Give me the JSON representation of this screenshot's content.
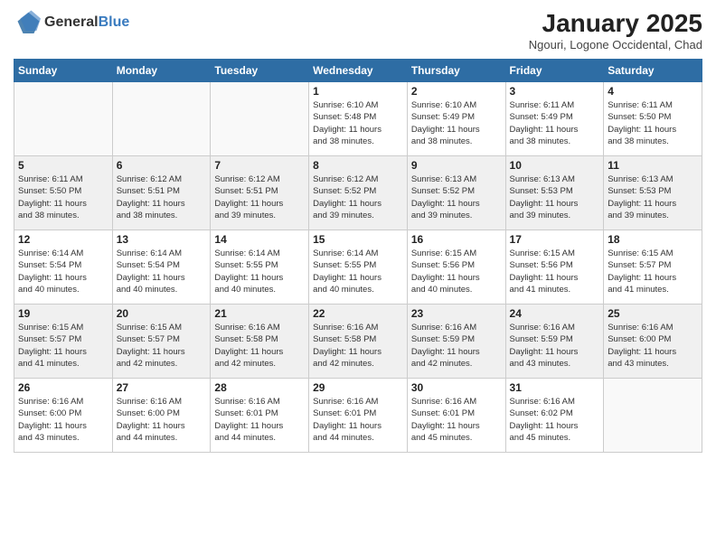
{
  "header": {
    "logo_general": "General",
    "logo_blue": "Blue",
    "title": "January 2025",
    "location": "Ngouri, Logone Occidental, Chad"
  },
  "days_of_week": [
    "Sunday",
    "Monday",
    "Tuesday",
    "Wednesday",
    "Thursday",
    "Friday",
    "Saturday"
  ],
  "weeks": [
    [
      {
        "day": "",
        "info": ""
      },
      {
        "day": "",
        "info": ""
      },
      {
        "day": "",
        "info": ""
      },
      {
        "day": "1",
        "info": "Sunrise: 6:10 AM\nSunset: 5:48 PM\nDaylight: 11 hours\nand 38 minutes."
      },
      {
        "day": "2",
        "info": "Sunrise: 6:10 AM\nSunset: 5:49 PM\nDaylight: 11 hours\nand 38 minutes."
      },
      {
        "day": "3",
        "info": "Sunrise: 6:11 AM\nSunset: 5:49 PM\nDaylight: 11 hours\nand 38 minutes."
      },
      {
        "day": "4",
        "info": "Sunrise: 6:11 AM\nSunset: 5:50 PM\nDaylight: 11 hours\nand 38 minutes."
      }
    ],
    [
      {
        "day": "5",
        "info": "Sunrise: 6:11 AM\nSunset: 5:50 PM\nDaylight: 11 hours\nand 38 minutes."
      },
      {
        "day": "6",
        "info": "Sunrise: 6:12 AM\nSunset: 5:51 PM\nDaylight: 11 hours\nand 38 minutes."
      },
      {
        "day": "7",
        "info": "Sunrise: 6:12 AM\nSunset: 5:51 PM\nDaylight: 11 hours\nand 39 minutes."
      },
      {
        "day": "8",
        "info": "Sunrise: 6:12 AM\nSunset: 5:52 PM\nDaylight: 11 hours\nand 39 minutes."
      },
      {
        "day": "9",
        "info": "Sunrise: 6:13 AM\nSunset: 5:52 PM\nDaylight: 11 hours\nand 39 minutes."
      },
      {
        "day": "10",
        "info": "Sunrise: 6:13 AM\nSunset: 5:53 PM\nDaylight: 11 hours\nand 39 minutes."
      },
      {
        "day": "11",
        "info": "Sunrise: 6:13 AM\nSunset: 5:53 PM\nDaylight: 11 hours\nand 39 minutes."
      }
    ],
    [
      {
        "day": "12",
        "info": "Sunrise: 6:14 AM\nSunset: 5:54 PM\nDaylight: 11 hours\nand 40 minutes."
      },
      {
        "day": "13",
        "info": "Sunrise: 6:14 AM\nSunset: 5:54 PM\nDaylight: 11 hours\nand 40 minutes."
      },
      {
        "day": "14",
        "info": "Sunrise: 6:14 AM\nSunset: 5:55 PM\nDaylight: 11 hours\nand 40 minutes."
      },
      {
        "day": "15",
        "info": "Sunrise: 6:14 AM\nSunset: 5:55 PM\nDaylight: 11 hours\nand 40 minutes."
      },
      {
        "day": "16",
        "info": "Sunrise: 6:15 AM\nSunset: 5:56 PM\nDaylight: 11 hours\nand 40 minutes."
      },
      {
        "day": "17",
        "info": "Sunrise: 6:15 AM\nSunset: 5:56 PM\nDaylight: 11 hours\nand 41 minutes."
      },
      {
        "day": "18",
        "info": "Sunrise: 6:15 AM\nSunset: 5:57 PM\nDaylight: 11 hours\nand 41 minutes."
      }
    ],
    [
      {
        "day": "19",
        "info": "Sunrise: 6:15 AM\nSunset: 5:57 PM\nDaylight: 11 hours\nand 41 minutes."
      },
      {
        "day": "20",
        "info": "Sunrise: 6:15 AM\nSunset: 5:57 PM\nDaylight: 11 hours\nand 42 minutes."
      },
      {
        "day": "21",
        "info": "Sunrise: 6:16 AM\nSunset: 5:58 PM\nDaylight: 11 hours\nand 42 minutes."
      },
      {
        "day": "22",
        "info": "Sunrise: 6:16 AM\nSunset: 5:58 PM\nDaylight: 11 hours\nand 42 minutes."
      },
      {
        "day": "23",
        "info": "Sunrise: 6:16 AM\nSunset: 5:59 PM\nDaylight: 11 hours\nand 42 minutes."
      },
      {
        "day": "24",
        "info": "Sunrise: 6:16 AM\nSunset: 5:59 PM\nDaylight: 11 hours\nand 43 minutes."
      },
      {
        "day": "25",
        "info": "Sunrise: 6:16 AM\nSunset: 6:00 PM\nDaylight: 11 hours\nand 43 minutes."
      }
    ],
    [
      {
        "day": "26",
        "info": "Sunrise: 6:16 AM\nSunset: 6:00 PM\nDaylight: 11 hours\nand 43 minutes."
      },
      {
        "day": "27",
        "info": "Sunrise: 6:16 AM\nSunset: 6:00 PM\nDaylight: 11 hours\nand 44 minutes."
      },
      {
        "day": "28",
        "info": "Sunrise: 6:16 AM\nSunset: 6:01 PM\nDaylight: 11 hours\nand 44 minutes."
      },
      {
        "day": "29",
        "info": "Sunrise: 6:16 AM\nSunset: 6:01 PM\nDaylight: 11 hours\nand 44 minutes."
      },
      {
        "day": "30",
        "info": "Sunrise: 6:16 AM\nSunset: 6:01 PM\nDaylight: 11 hours\nand 45 minutes."
      },
      {
        "day": "31",
        "info": "Sunrise: 6:16 AM\nSunset: 6:02 PM\nDaylight: 11 hours\nand 45 minutes."
      },
      {
        "day": "",
        "info": ""
      }
    ]
  ]
}
